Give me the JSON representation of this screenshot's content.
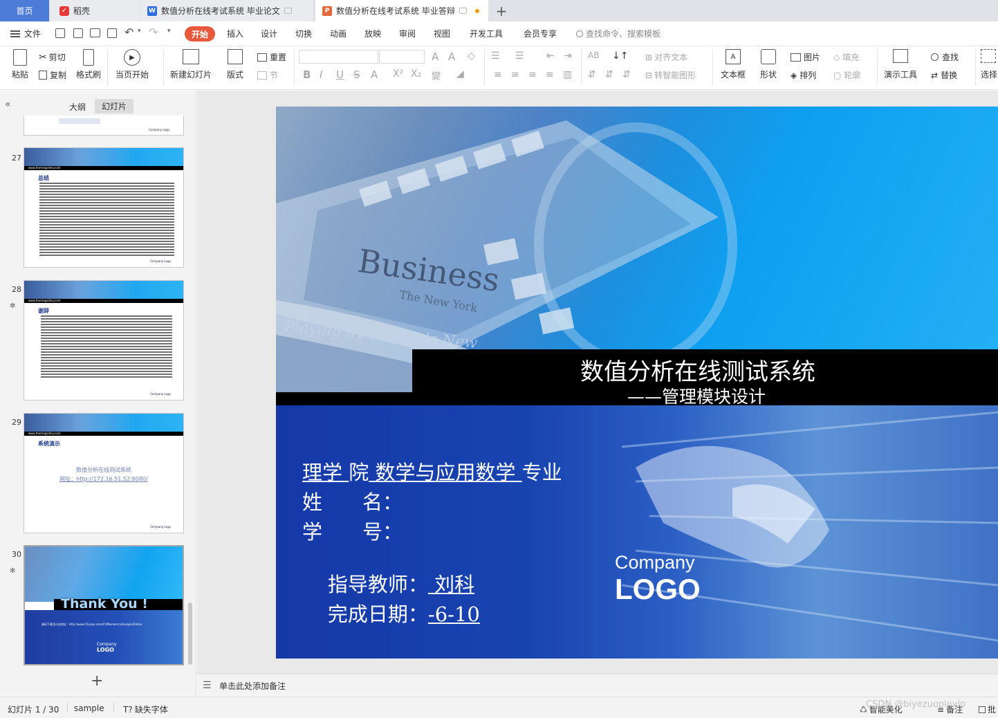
{
  "tabs": {
    "home": "首页",
    "daoke": "稻壳",
    "doc": "数值分析在线考试系统 毕业论文",
    "ppt": "数值分析在线考试系统 毕业答辩",
    "new": "+"
  },
  "menubar": {
    "file": "文件",
    "items": [
      "开始",
      "插入",
      "设计",
      "切换",
      "动画",
      "放映",
      "审阅",
      "视图",
      "开发工具",
      "会员专享"
    ],
    "search": "查找命令、搜索模板"
  },
  "ribbon": {
    "paste": "粘贴",
    "cut": "剪切",
    "copy": "复制",
    "format_painter": "格式刷",
    "from_current": "当页开始",
    "new_slide": "新建幻灯片",
    "layout": "版式",
    "reset": "重置",
    "section": "节",
    "align_text": "对齐文本",
    "smart_graphic": "转智能图形",
    "textbox": "文本框",
    "shape": "形状",
    "picture": "图片",
    "arrange": "排列",
    "fill": "填充",
    "outline": "轮廓",
    "presentation_tools": "演示工具",
    "find": "查找",
    "replace": "替换",
    "select": "选择"
  },
  "leftpanel": {
    "tab_outline": "大纲",
    "tab_slides": "幻灯片",
    "slides": [
      {
        "num": "27",
        "heading": "总结",
        "url": "www.themegallery.com",
        "logo": "Company Logo"
      },
      {
        "num": "28",
        "heading": "谢辞",
        "url": "www.themegallery.com",
        "logo": "Company Logo"
      },
      {
        "num": "29",
        "heading": "系统演示",
        "url": "www.themegallery.com",
        "logo": "Company Logo",
        "line1": "数值分析在线测试系统",
        "line2": "网址：http://172.16.51.52:8080/"
      },
      {
        "num": "30",
        "thanks": "Thank You !",
        "line": "源码下载及讨论地址：http://www.51aspx.com/CV/NumericalAnalysisOnline",
        "logo1": "Company",
        "logo2": "LOGO"
      }
    ],
    "add": "+"
  },
  "slide": {
    "title": "数值分析在线测试系统",
    "subtitle": "——管理模块设计",
    "dept_a": " 理学 ",
    "dept_b": "院",
    "dept_c": " 数学与应用数学 ",
    "dept_d": "专业",
    "name_label": "姓　　名：",
    "id_label": "学　　号：",
    "advisor_label": "指导教师：",
    "advisor": " 刘科",
    "date_label": "完成日期：",
    "date": "-6-10",
    "company": "Company",
    "logo": "LOGO",
    "img_business": "Business",
    "img_nyt": "The New York",
    "img_playing": "Playing by Europe's New"
  },
  "notes": {
    "placeholder": "单击此处添加备注"
  },
  "status": {
    "slide_count": "幻灯片 1 / 30",
    "theme": "sample",
    "missing_font": "缺失字体",
    "smart": "智能美化",
    "notes": "备注",
    "comment": "批",
    "watermark": "CSDN @biyezuopinvip"
  }
}
